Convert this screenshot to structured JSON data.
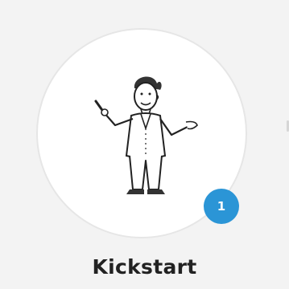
{
  "card": {
    "title": "Kickstart",
    "badge_count": "1",
    "illustration_icon": "presenter-man-illustration"
  },
  "colors": {
    "background": "#f3f3f3",
    "circle_fill": "#ffffff",
    "badge": "#2b95d6",
    "title_text": "#222222"
  }
}
